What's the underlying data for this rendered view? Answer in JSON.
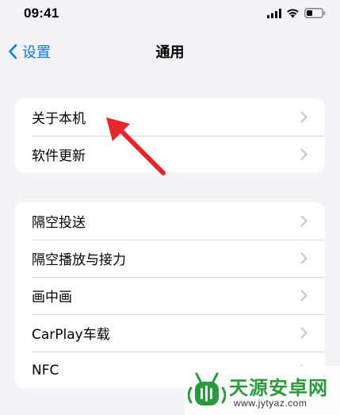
{
  "status_bar": {
    "time": "09:41",
    "icons": [
      "cellular-signal-icon",
      "wifi-icon",
      "battery-icon"
    ]
  },
  "nav": {
    "back_label": "设置",
    "title": "通用"
  },
  "groups": [
    {
      "items": [
        {
          "label": "关于本机"
        },
        {
          "label": "软件更新"
        }
      ]
    },
    {
      "items": [
        {
          "label": "隔空投送"
        },
        {
          "label": "隔空播放与接力"
        },
        {
          "label": "画中画"
        },
        {
          "label": "CarPlay车载"
        },
        {
          "label": "NFC"
        }
      ]
    }
  ],
  "annotation": {
    "icon": "red-arrow-icon",
    "target": "关于本机",
    "color": "#e8262c"
  },
  "watermark": {
    "brand": "天源安卓网",
    "url": "www.jytyaz.com",
    "color": "#2b9a3c"
  },
  "colors": {
    "background": "#f2f2f7",
    "card": "#ffffff",
    "accent": "#0a7aff",
    "chevron": "#c4c4c7",
    "separator": "#d9d9de"
  }
}
